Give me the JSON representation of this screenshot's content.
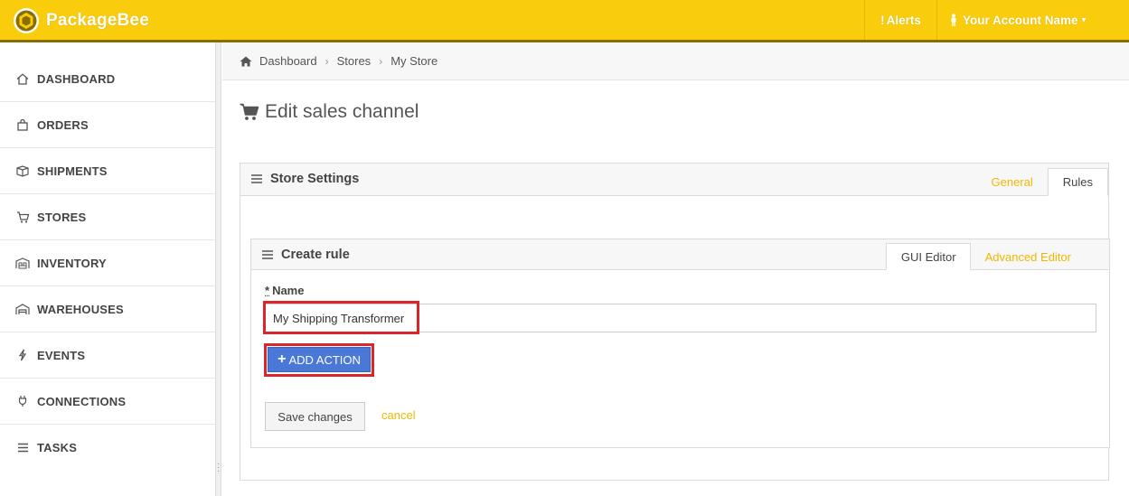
{
  "app": {
    "name": "PackageBee"
  },
  "header": {
    "alerts_label": "Alerts",
    "account_label": "Your Account Name"
  },
  "sidebar": {
    "items": [
      {
        "label": "DASHBOARD",
        "icon": "home-icon"
      },
      {
        "label": "ORDERS",
        "icon": "shopping-bag-icon"
      },
      {
        "label": "SHIPMENTS",
        "icon": "package-icon"
      },
      {
        "label": "STORES",
        "icon": "cart-icon"
      },
      {
        "label": "INVENTORY",
        "icon": "inventory-icon"
      },
      {
        "label": "WAREHOUSES",
        "icon": "warehouse-icon"
      },
      {
        "label": "EVENTS",
        "icon": "bolt-icon"
      },
      {
        "label": "CONNECTIONS",
        "icon": "plug-icon"
      },
      {
        "label": "TASKS",
        "icon": "list-icon"
      }
    ]
  },
  "breadcrumb": {
    "items": [
      "Dashboard",
      "Stores",
      "My Store"
    ]
  },
  "page": {
    "title": "Edit sales channel"
  },
  "store_settings": {
    "title": "Store Settings",
    "tabs": [
      {
        "label": "General",
        "active": false
      },
      {
        "label": "Rules",
        "active": true
      }
    ]
  },
  "create_rule": {
    "title": "Create rule",
    "tabs": [
      {
        "label": "GUI Editor",
        "active": true
      },
      {
        "label": "Advanced Editor",
        "active": false
      }
    ],
    "name_label": "Name",
    "required_mark": "*",
    "name_value": "My Shipping Transformer",
    "add_action_label": "ADD ACTION",
    "save_label": "Save changes",
    "cancel_label": "cancel"
  },
  "colors": {
    "brand": "#f9cd0b",
    "link": "#f0b800",
    "primary_button": "#4a78d6",
    "highlight": "#d9262c"
  }
}
